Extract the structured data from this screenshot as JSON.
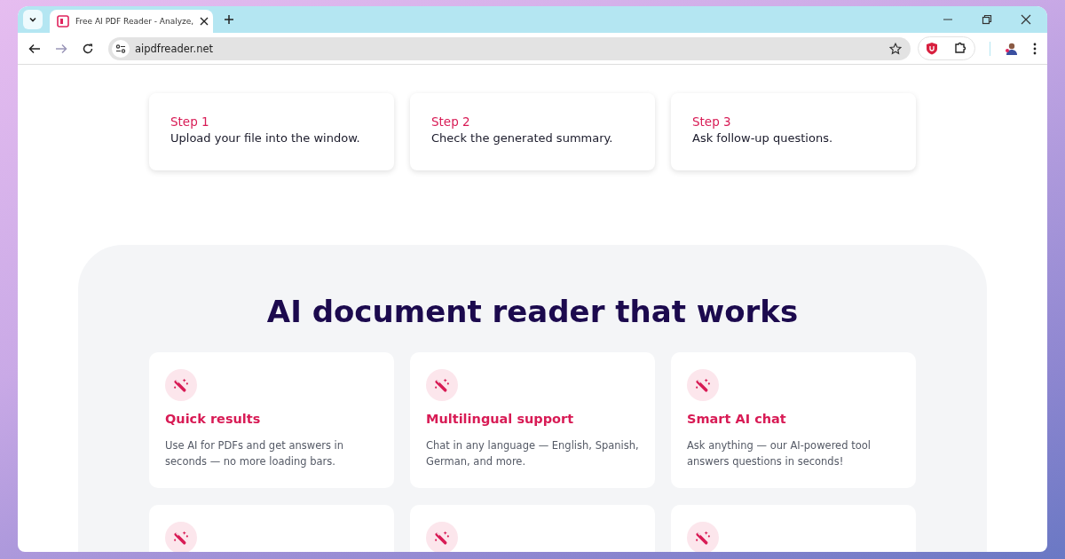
{
  "browser": {
    "tab": {
      "title": "Free AI PDF Reader - Analyze,",
      "selected": true
    },
    "address": "aipdfreader.net"
  },
  "steps": [
    {
      "label": "Step 1",
      "text": "Upload your file into the window."
    },
    {
      "label": "Step 2",
      "text": "Check the generated summary."
    },
    {
      "label": "Step 3",
      "text": "Ask follow-up questions."
    }
  ],
  "features_section": {
    "heading": "AI document reader that works",
    "cards": [
      {
        "kind": "full",
        "title": "Quick results",
        "text": "Use AI for PDFs and get answers in seconds — no more loading bars."
      },
      {
        "kind": "full",
        "title": "Multilingual support",
        "text": "Chat in any language — English, Spanish, German, and more."
      },
      {
        "kind": "full",
        "title": "Smart AI chat",
        "text": "Ask anything — our AI-powered tool answers questions in seconds!"
      },
      {
        "kind": "cut_off"
      },
      {
        "kind": "cut_off"
      },
      {
        "kind": "cut_off"
      }
    ]
  }
}
